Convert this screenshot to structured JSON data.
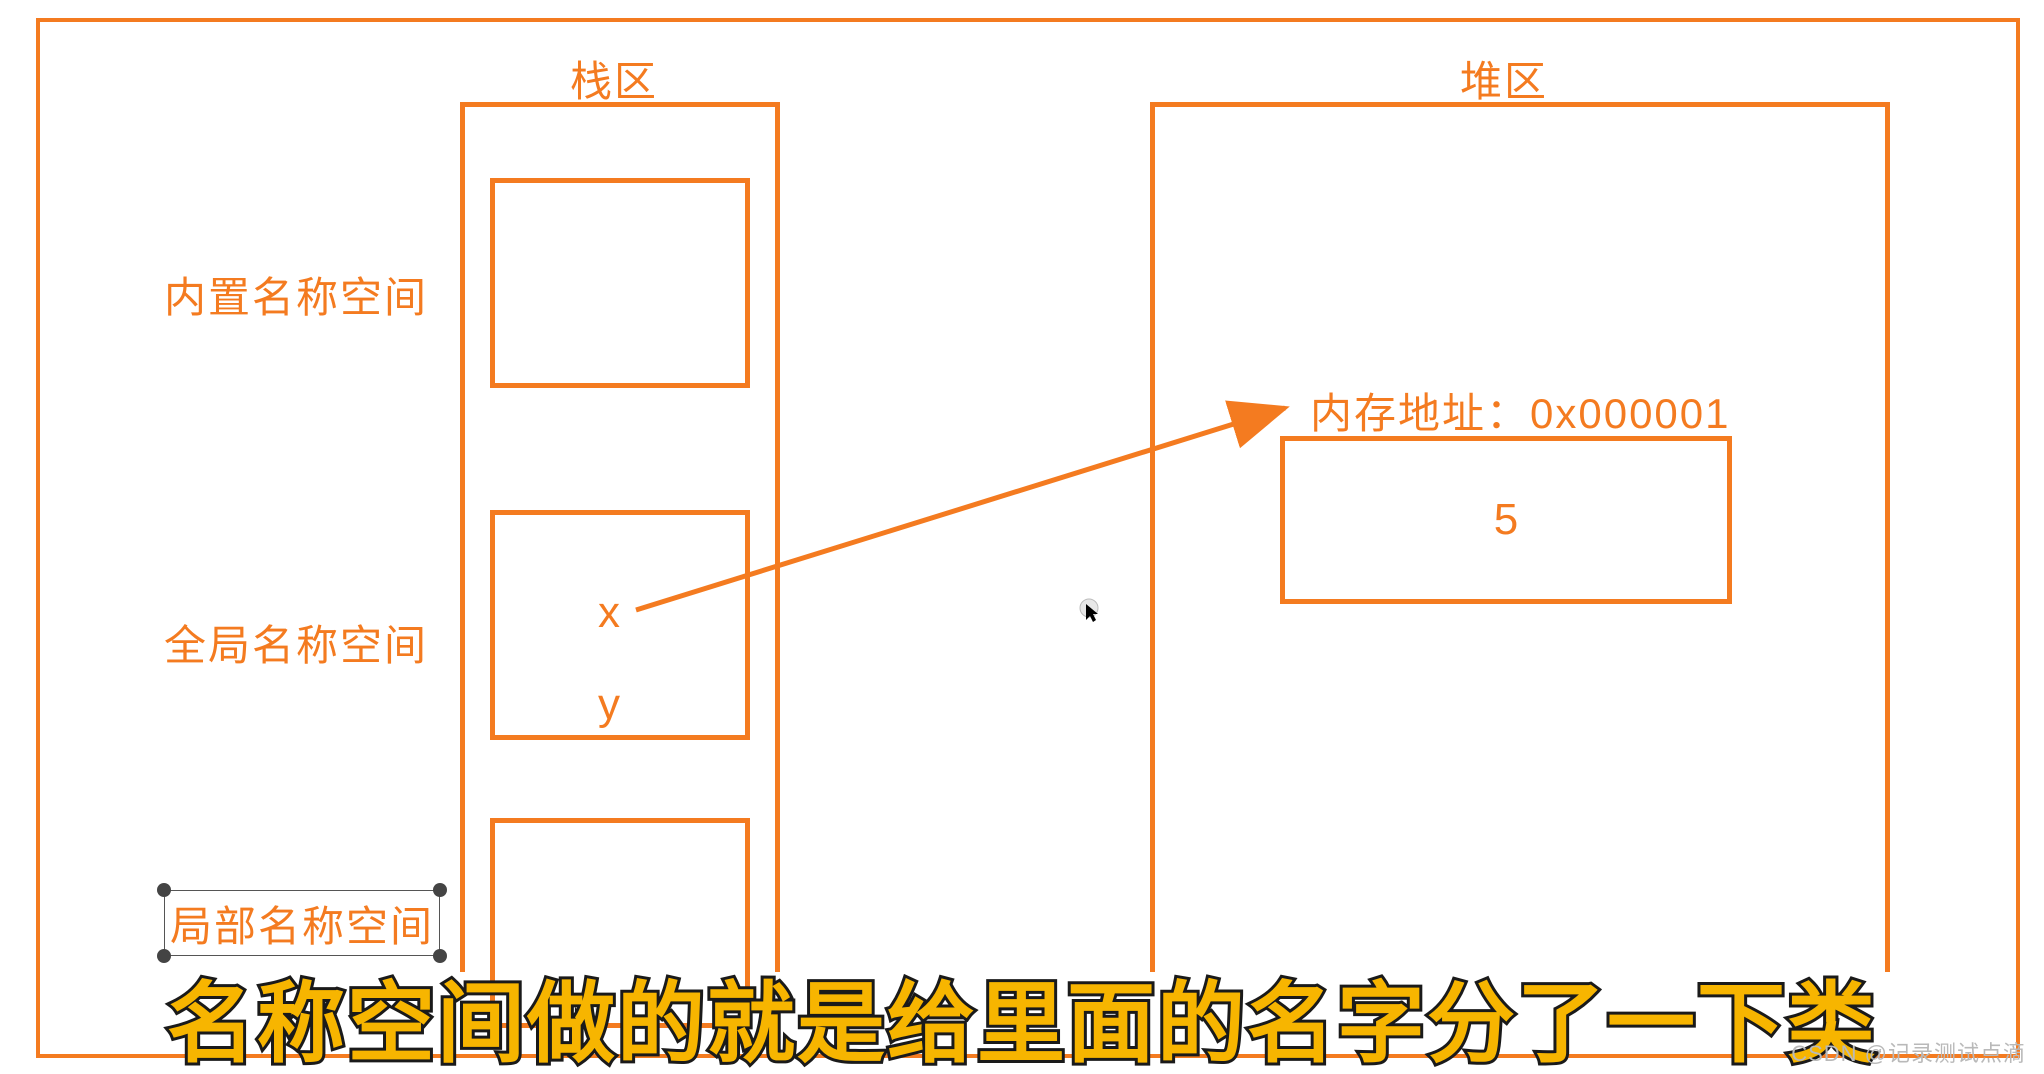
{
  "stack": {
    "title": "栈区",
    "labels": {
      "builtin": "内置名称空间",
      "global": "全局名称空间",
      "local": "局部名称空间"
    },
    "global_box": {
      "var1": "x",
      "var2": "y"
    }
  },
  "heap": {
    "title": "堆区",
    "address_label": "内存地址：0x000001",
    "value": "5"
  },
  "caption": "名称空间做的就是给里面的名字分了一下类",
  "watermark": "CSDN @记录测试点滴"
}
